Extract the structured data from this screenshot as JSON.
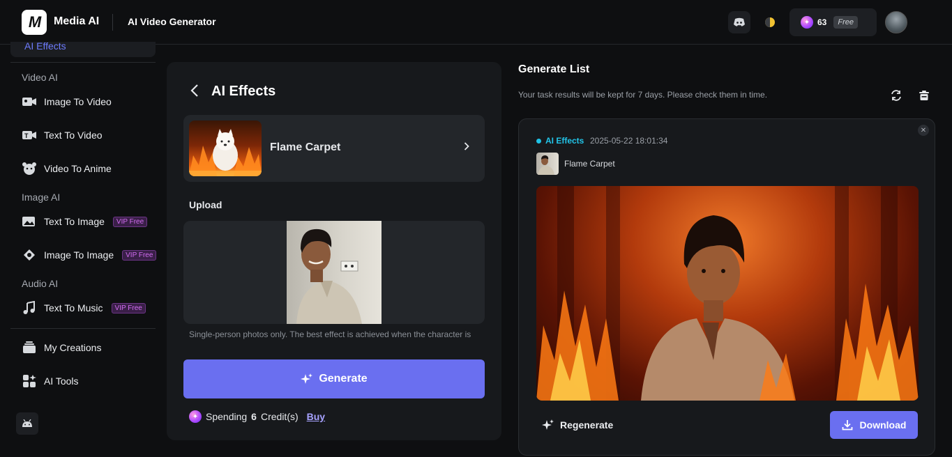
{
  "header": {
    "logo_text": "M",
    "brand": "Media AI",
    "title": "AI Video Generator",
    "credits": "63",
    "plan_badge": "Free"
  },
  "sidebar": {
    "active_item": "AI Effects",
    "sections": [
      {
        "title": "Video AI",
        "items": [
          {
            "label": "Image To Video",
            "icon": "image-to-video-icon"
          },
          {
            "label": "Text To Video",
            "icon": "text-to-video-icon"
          },
          {
            "label": "Video To Anime",
            "icon": "anime-icon"
          }
        ]
      },
      {
        "title": "Image AI",
        "items": [
          {
            "label": "Text To Image",
            "icon": "text-to-image-icon",
            "badge": "VIP Free"
          },
          {
            "label": "Image To Image",
            "icon": "image-to-image-icon",
            "badge": "VIP Free"
          }
        ]
      },
      {
        "title": "Audio AI",
        "items": [
          {
            "label": "Text To Music",
            "icon": "music-icon",
            "badge": "VIP Free"
          }
        ]
      }
    ],
    "bottom_items": [
      {
        "label": "My Creations",
        "icon": "creations-icon"
      },
      {
        "label": "AI Tools",
        "icon": "tools-icon"
      }
    ]
  },
  "panel": {
    "title": "AI Effects",
    "effect_name": "Flame Carpet",
    "upload_label": "Upload",
    "hint": "Single-person photos only. The best effect is achieved when the character is",
    "generate_label": "Generate",
    "spending_prefix": "Spending",
    "spending_amount": "6",
    "spending_suffix": "Credit(s)",
    "buy_label": "Buy"
  },
  "generate_list": {
    "title": "Generate List",
    "subtitle": "Your task results will be kept for 7 days. Please check them in time.",
    "result": {
      "tag": "AI Effects",
      "timestamp": "2025-05-22 18:01:34",
      "effect_name": "Flame Carpet",
      "regenerate_label": "Regenerate",
      "download_label": "Download"
    }
  },
  "colors": {
    "accent": "#6a6ff0",
    "tag": "#22c4e8",
    "vip": "#d36df2"
  }
}
